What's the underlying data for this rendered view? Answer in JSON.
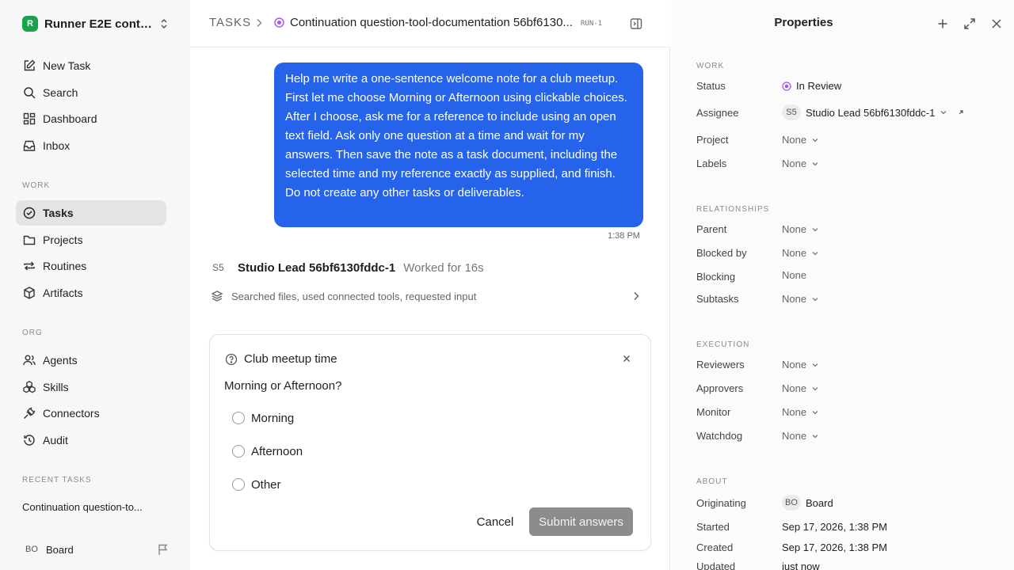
{
  "sidebar": {
    "workspace": {
      "logo": "R",
      "name": "Runner E2E conti..."
    },
    "nav": [
      {
        "label": "New Task",
        "icon": "pencil-square-icon"
      },
      {
        "label": "Search",
        "icon": "search-icon"
      },
      {
        "label": "Dashboard",
        "icon": "dashboard-icon"
      },
      {
        "label": "Inbox",
        "icon": "inbox-icon"
      }
    ],
    "work_label": "WORK",
    "work": [
      {
        "label": "Tasks",
        "icon": "check-circle-icon",
        "active": true
      },
      {
        "label": "Projects",
        "icon": "folder-icon"
      },
      {
        "label": "Routines",
        "icon": "repeat-icon"
      },
      {
        "label": "Artifacts",
        "icon": "cube-icon"
      }
    ],
    "org_label": "ORG",
    "org": [
      {
        "label": "Agents",
        "icon": "users-icon"
      },
      {
        "label": "Skills",
        "icon": "boxes-icon"
      },
      {
        "label": "Connectors",
        "icon": "plug-icon"
      },
      {
        "label": "Audit",
        "icon": "history-icon"
      }
    ],
    "recent_label": "RECENT TASKS",
    "recent_tasks": [
      "Continuation question-to..."
    ],
    "user": {
      "initials": "BO",
      "name": "Board"
    }
  },
  "header": {
    "root": "TASKS",
    "title": "Continuation question-tool-documentation 56bf6130...",
    "run_badge": "RUN-1"
  },
  "colors": {
    "accent": "#2563eb",
    "status_review": "#a855f7",
    "workspace_logo": "#16a34a"
  },
  "conversation": {
    "user_message": "Help me write a one-sentence welcome note for a club meetup. First let me choose Morning or Afternoon using clickable choices. After I choose, ask me for a reference to include using an open text field. Ask only one question at a time and wait for my answers. Then save the note as a task document, including the selected time and my reference exactly as supplied, and finish. Do not create any other tasks or deliverables.",
    "message_time": "1:38 PM",
    "agent": {
      "initials": "S5",
      "name": "Studio Lead 56bf6130fddc-1",
      "worked": "Worked for 16s"
    },
    "activity": "Searched files, used connected tools, requested input"
  },
  "question": {
    "title": "Club meetup time",
    "text": "Morning or Afternoon?",
    "options": [
      "Morning",
      "Afternoon",
      "Other"
    ],
    "cancel_label": "Cancel",
    "submit_label": "Submit answers"
  },
  "properties": {
    "title": "Properties",
    "sections": {
      "work": "WORK",
      "relationships": "RELATIONSHIPS",
      "execution": "EXECUTION",
      "about": "ABOUT"
    },
    "status": {
      "label": "Status",
      "value": "In Review"
    },
    "assignee": {
      "label": "Assignee",
      "initials": "S5",
      "value": "Studio Lead 56bf6130fddc-1"
    },
    "project": {
      "label": "Project",
      "value": "None"
    },
    "labels": {
      "label": "Labels",
      "value": "None"
    },
    "parent": {
      "label": "Parent",
      "value": "None"
    },
    "blocked_by": {
      "label": "Blocked by",
      "value": "None"
    },
    "blocking": {
      "label": "Blocking",
      "value": "None"
    },
    "subtasks": {
      "label": "Subtasks",
      "value": "None"
    },
    "reviewers": {
      "label": "Reviewers",
      "value": "None"
    },
    "approvers": {
      "label": "Approvers",
      "value": "None"
    },
    "monitor": {
      "label": "Monitor",
      "value": "None"
    },
    "watchdog": {
      "label": "Watchdog",
      "value": "None"
    },
    "originating": {
      "label": "Originating",
      "initials": "BO",
      "value": "Board"
    },
    "started": {
      "label": "Started",
      "value": "Sep 17, 2026, 1:38 PM"
    },
    "created": {
      "label": "Created",
      "value": "Sep 17, 2026, 1:38 PM"
    },
    "updated": {
      "label": "Updated",
      "value": "just now"
    }
  }
}
